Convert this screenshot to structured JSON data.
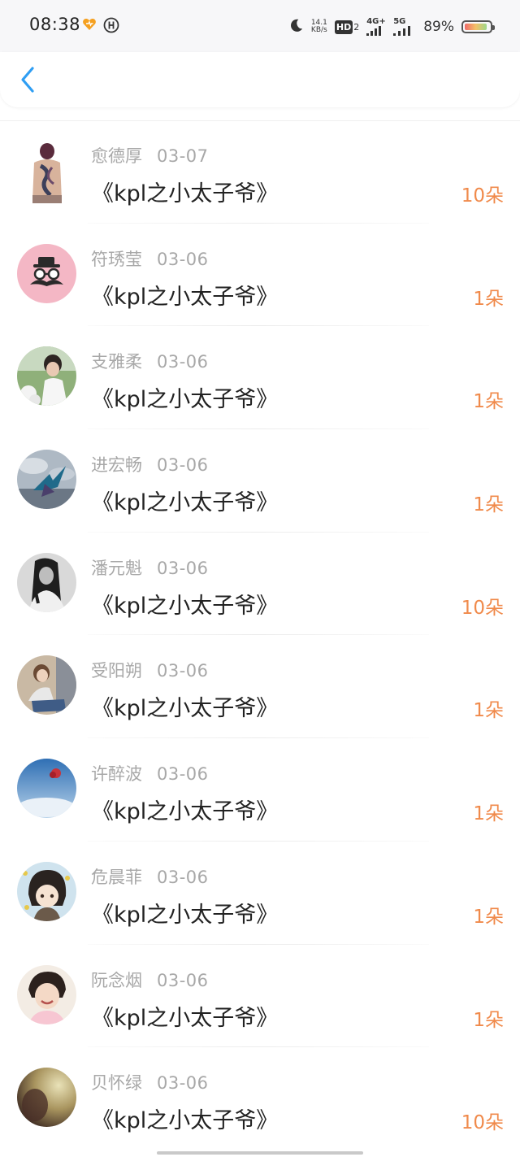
{
  "status_bar": {
    "time": "08:38",
    "network_speed_value": "14.1",
    "network_speed_unit": "KB/s",
    "hd_label": "HD",
    "hd_sub": "2",
    "net_4g": "4G+",
    "net_5g": "5G",
    "battery_percent": "89%",
    "battery_level": 0.89,
    "icons": [
      "heart-app-icon",
      "app-icon",
      "moon-icon",
      "hd-icon",
      "signal-4g-icon",
      "signal-5g-icon",
      "battery-icon"
    ]
  },
  "nav": {
    "back_icon": "chevron-left-icon",
    "accent": "#2f9ef3"
  },
  "colors": {
    "amount": "#f08a4b",
    "name": "#a8a8a8",
    "title": "#222222"
  },
  "items": [
    {
      "name": "愈德厚",
      "date": "03-07",
      "title": "《kpl之小太子爷》",
      "amount": "10朵",
      "avatar": "tattoo-back-avatar"
    },
    {
      "name": "符琇莹",
      "date": "03-06",
      "title": "《kpl之小太子爷》",
      "amount": "1朵",
      "avatar": "mustache-glasses-avatar"
    },
    {
      "name": "支雅柔",
      "date": "03-06",
      "title": "《kpl之小太子爷》",
      "amount": "1朵",
      "avatar": "boy-photo-avatar"
    },
    {
      "name": "进宏畅",
      "date": "03-06",
      "title": "《kpl之小太子爷》",
      "amount": "1朵",
      "avatar": "sky-bird-avatar"
    },
    {
      "name": "潘元魁",
      "date": "03-06",
      "title": "《kpl之小太子爷》",
      "amount": "10朵",
      "avatar": "girl-bw-avatar"
    },
    {
      "name": "受阳朔",
      "date": "03-06",
      "title": "《kpl之小太子爷》",
      "amount": "1朵",
      "avatar": "girl-sitting-avatar"
    },
    {
      "name": "许醉波",
      "date": "03-06",
      "title": "《kpl之小太子爷》",
      "amount": "1朵",
      "avatar": "sky-flower-avatar"
    },
    {
      "name": "危晨菲",
      "date": "03-06",
      "title": "《kpl之小太子爷》",
      "amount": "1朵",
      "avatar": "anime-boy-avatar"
    },
    {
      "name": "阮念烟",
      "date": "03-06",
      "title": "《kpl之小太子爷》",
      "amount": "1朵",
      "avatar": "smiling-girl-avatar"
    },
    {
      "name": "贝怀绿",
      "date": "03-06",
      "title": "《kpl之小太子爷》",
      "amount": "10朵",
      "avatar": "blurry-photo-avatar"
    }
  ]
}
